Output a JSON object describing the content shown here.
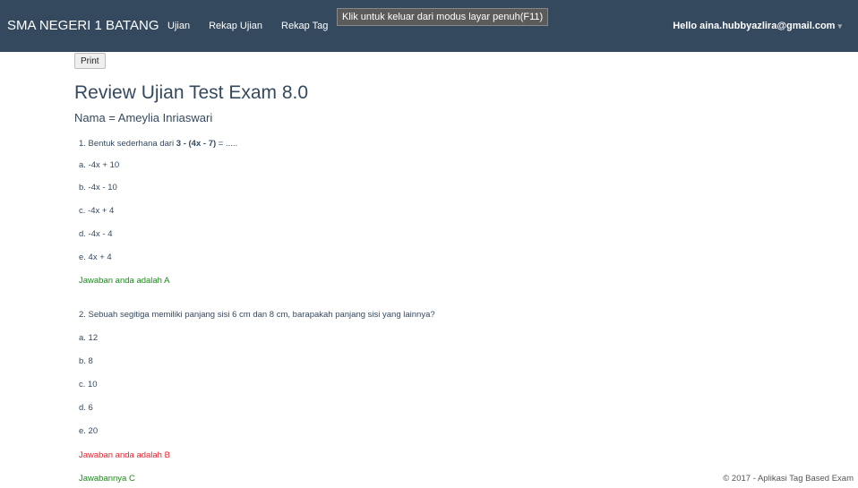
{
  "navbar": {
    "brand": "SMA NEGERI 1 BATANG",
    "links": [
      "Ujian",
      "Rekap Ujian",
      "Rekap Tag"
    ],
    "user": "Hello aina.hubbyazlira@gmail.com",
    "fullscreen_tip": "Klik untuk keluar dari modus layar penuh(F11)"
  },
  "toolbar": {
    "print_label": "Print"
  },
  "header": {
    "title": "Review Ujian Test Exam 8.0",
    "student": "Nama = Ameylia Inriaswari"
  },
  "questions": [
    {
      "number_prefix": "1. Bentuk sederhana dari ",
      "bold_part": "3 - (4x - 7)",
      "suffix": " = .....",
      "options": [
        "a. -4x + 10",
        "b. -4x - 10",
        "c. -4x + 4",
        "d. -4x - 4",
        "e. 4x + 4"
      ],
      "your_answer": "Jawaban anda adalah A"
    },
    {
      "text": "2. Sebuah segitiga memiliki panjang sisi 6 cm dan 8 cm, barapakah panjang sisi yang lainnya?",
      "options": [
        "a. 12",
        "b. 8",
        "c. 10",
        "d. 6",
        "e. 20"
      ],
      "your_answer": "Jawaban anda adalah B",
      "correct_answer": "Jawabannya C"
    }
  ],
  "footer": "© 2017 - Aplikasi Tag Based Exam",
  "colors": {
    "navbar_bg": "#34495e",
    "correct": "#1a8a1a",
    "wrong": "#e8222a"
  }
}
